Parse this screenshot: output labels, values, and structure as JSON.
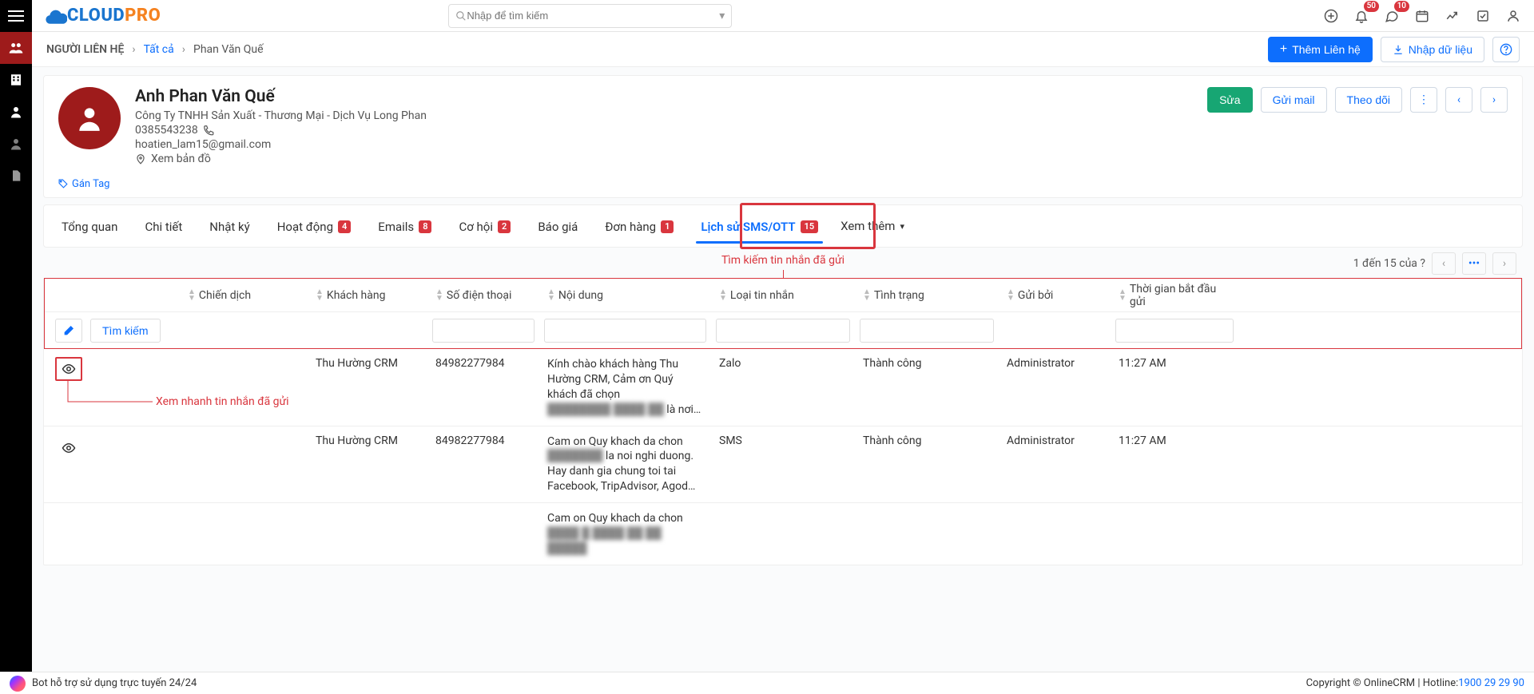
{
  "top": {
    "search_placeholder": "Nhập để tìm kiếm",
    "bell_badge": "50",
    "chat_badge": "10"
  },
  "breadcrumb": {
    "root": "NGƯỜI LIÊN HỆ",
    "all": "Tất cả",
    "current": "Phan Văn Quế"
  },
  "actions": {
    "add": "Thêm Liên hệ",
    "import": "Nhập dữ liệu"
  },
  "contact": {
    "name": "Anh Phan Văn Quế",
    "company": "Công Ty TNHH Sản Xuất - Thương Mại - Dịch Vụ Long Phan",
    "phone": "0385543238",
    "email": "hoatien_lam15@gmail.com",
    "map": "Xem bản đồ",
    "tag": "Gán Tag",
    "edit": "Sửa",
    "sendmail": "Gửi mail",
    "follow": "Theo dõi"
  },
  "tabs": {
    "overview": "Tổng quan",
    "detail": "Chi tiết",
    "diary": "Nhật ký",
    "activity": "Hoạt động",
    "activity_badge": "4",
    "emails": "Emails",
    "emails_badge": "8",
    "opp": "Cơ hội",
    "opp_badge": "2",
    "quote": "Báo giá",
    "order": "Đơn hàng",
    "order_badge": "1",
    "sms": "Lịch sử SMS/OTT",
    "sms_badge": "15",
    "more": "Xem thêm"
  },
  "annot": {
    "search_hint": "Tìm kiếm tin nhắn đã gửi",
    "row_hint": "Xem nhanh tin nhắn đã gửi"
  },
  "pager": {
    "text": "1 đến 15 của  ?"
  },
  "table": {
    "headers": {
      "campaign": "Chiến dịch",
      "customer": "Khách hàng",
      "phone": "Số điện thoại",
      "content": "Nội dung",
      "type": "Loại tin nhắn",
      "status": "Tình trạng",
      "sender": "Gửi bởi",
      "time": "Thời gian bắt đầu gửi"
    },
    "filter": {
      "search": "Tìm kiếm"
    },
    "rows": [
      {
        "customer": "Thu Hường CRM",
        "phone": "84982277984",
        "content_pre": "Kính chào khách hàng Thu Hường CRM,\nCảm ơn Quý khách đã chọn",
        "content_blur": "████████ ████ ██",
        "content_post": " là nơi…",
        "type": "Zalo",
        "status": "Thành công",
        "sender": "Administrator",
        "time": "11:27 AM"
      },
      {
        "customer": "Thu Hường CRM",
        "phone": "84982277984",
        "content_pre": "Cam on Quy khach da chon",
        "content_blur": "███████",
        "content_post": " la noi nghi duong. Hay danh gia chung toi tai Facebook, TripAdvisor, Agod…",
        "type": "SMS",
        "status": "Thành công",
        "sender": "Administrator",
        "time": "11:27 AM"
      },
      {
        "customer": "",
        "phone": "",
        "content_pre": "Cam on Quy khach da chon",
        "content_blur": "",
        "content_post": "",
        "type": "",
        "status": "",
        "sender": "",
        "time": ""
      }
    ]
  },
  "footer": {
    "bot": "Bot hỗ trợ sử dụng trực tuyến 24/24",
    "copyright": "Copyright © OnlineCRM",
    "hotlabel": "Hotline: ",
    "hotline": "1900 29 29 90"
  }
}
